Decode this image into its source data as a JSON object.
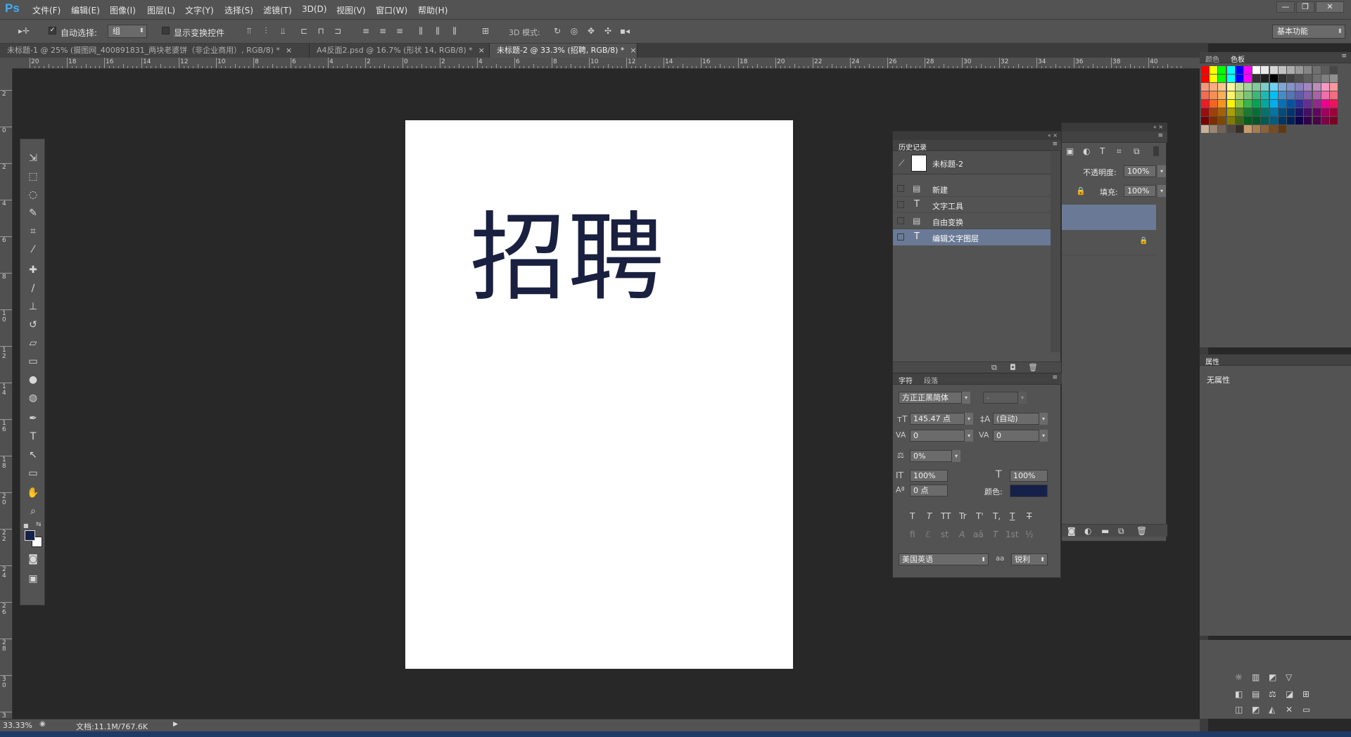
{
  "app": {
    "logo": "Ps"
  },
  "menu": [
    "文件(F)",
    "编辑(E)",
    "图像(I)",
    "图层(L)",
    "文字(Y)",
    "选择(S)",
    "滤镜(T)",
    "3D(D)",
    "视图(V)",
    "窗口(W)",
    "帮助(H)"
  ],
  "window_controls": {
    "minimize": "—",
    "restore": "❐",
    "close": "✕"
  },
  "options": {
    "auto_select_label": "自动选择:",
    "auto_select_value": "组",
    "show_transform_label": "显示变换控件",
    "mode_3d_label": "3D 模式:",
    "workspace": "基本功能"
  },
  "tabs": [
    {
      "label": "未标题-1 @ 25% (摄图网_400891831_两块老婆饼（非企业商用）, RGB/8) *",
      "close": "×"
    },
    {
      "label": "A4反面2.psd @ 16.7% (形状 14, RGB/8) *",
      "close": "×"
    },
    {
      "label": "未标题-2 @ 33.3% (招聘, RGB/8) *",
      "close": "×"
    }
  ],
  "hruler_numbers": [
    "20",
    "18",
    "16",
    "14",
    "12",
    "10",
    "8",
    "6",
    "4",
    "2",
    "0",
    "2",
    "4",
    "6",
    "8",
    "10",
    "12",
    "14",
    "16",
    "18",
    "20",
    "22",
    "24",
    "26",
    "28",
    "30",
    "32",
    "34",
    "36",
    "38",
    "40"
  ],
  "vruler_numbers": [
    "2",
    "0",
    "2",
    "4",
    "6",
    "8",
    "1 0",
    "1 2",
    "1 4",
    "1 6",
    "1 8",
    "2 0",
    "2 2",
    "2 4",
    "2 6",
    "2 8",
    "3 0",
    "3 2"
  ],
  "canvas": {
    "text": "招聘",
    "text_color": "#1a2040"
  },
  "history": {
    "title": "历史记录",
    "snapshot": "未标题-2",
    "items": [
      {
        "icon": "▤",
        "label": "新建"
      },
      {
        "icon": "T",
        "label": "文字工具"
      },
      {
        "icon": "▤",
        "label": "自由变换"
      },
      {
        "icon": "T",
        "label": "编辑文字图层"
      }
    ]
  },
  "layers": {
    "opacity_label": "不透明度:",
    "opacity_value": "100%",
    "fill_label": "填充:",
    "fill_value": "100%"
  },
  "character": {
    "tab_character": "字符",
    "tab_paragraph": "段落",
    "font_family": "方正正黑简体",
    "font_style": "-",
    "font_size": "145.47 点",
    "leading": "(自动)",
    "kerning": "0",
    "tracking": "0",
    "tsume": "0%",
    "vertical_scale": "100%",
    "horizontal_scale": "100%",
    "baseline_shift": "0 点",
    "color_label": "颜色:",
    "color": "#16214a",
    "style_buttons": [
      "T",
      "T",
      "TT",
      "Tr",
      "T'",
      "T,",
      "T",
      "T"
    ],
    "opentype_buttons": [
      "fi",
      "ℰ",
      "st",
      "A",
      "aā",
      "T",
      "1st",
      "½"
    ],
    "language": "美国英语",
    "aa_label": "aa",
    "antialias": "锐利"
  },
  "swatches": {
    "tab_color": "颜色",
    "tab_swatches": "色板"
  },
  "properties": {
    "title": "属性",
    "content": "无属性"
  },
  "status": {
    "zoom": "33.33%",
    "doc_info": "文档:11.1M/767.6K"
  }
}
